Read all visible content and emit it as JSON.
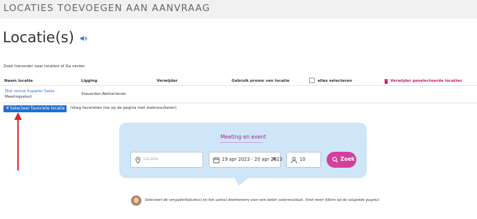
{
  "page": {
    "title": "LOCATIES TOEVOEGEN AAN AANVRAAG",
    "heading": "Locatie(s)",
    "hint": "Zoek hieronder naar locaties of Ga verder."
  },
  "table": {
    "headers": {
      "name": "Naam locatie",
      "location": "Ligging",
      "remove": "Verwijder",
      "promo": "Gebruik promo van locatie",
      "select_all": "alles selecteren",
      "delete_selected": "Verwijder geselecteerde locaties"
    },
    "rows": [
      {
        "name": "Test venue Supplier Sales",
        "subtitle": "Meetingselect",
        "location": "Staverden,Netherlands"
      }
    ]
  },
  "favorites": {
    "button_label": "Selecteer favoriete locatie",
    "note": "(Voeg favorieten toe op de pagina met zoekresultaten)"
  },
  "search": {
    "tab_label": "Meeting en event",
    "location_placeholder": "Locatie",
    "date_range": "19 apr 2023 - 20 apr 2023",
    "clear_symbol": "✕",
    "attendees": "10",
    "submit_label": "Zoek"
  },
  "footer": {
    "tip": "Selecteer de vergaderdatum(s) en het aantal deelnemers voor een beter zoekresultaat. Vind meer filters op de volgende pagina!"
  },
  "colors": {
    "primary_button": "#1d6fd1",
    "search_button": "#d43f9a",
    "panel_bg": "#cfe6f9",
    "delete_accent": "#c41d6e",
    "annotation_arrow": "#d62b2b"
  }
}
